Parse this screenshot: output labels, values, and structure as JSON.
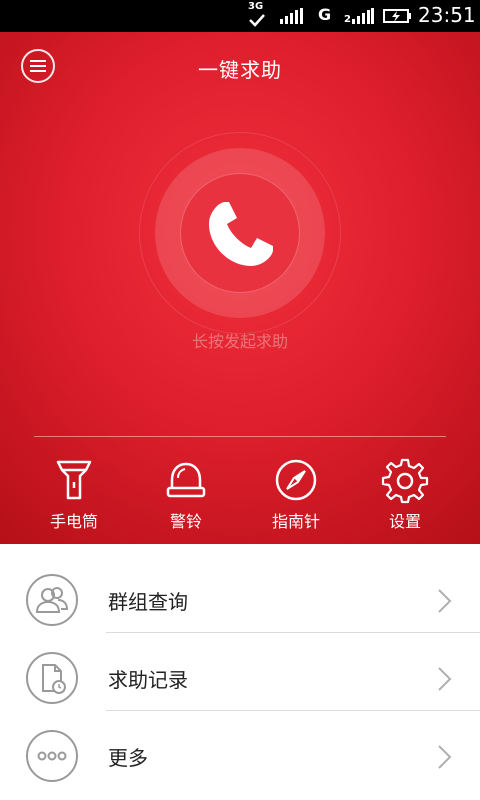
{
  "status_bar": {
    "network_label": "3G",
    "g_label": "G",
    "time": "23:51"
  },
  "header": {
    "title": "一键求助",
    "menu_icon": "menu-icon"
  },
  "call": {
    "hint": "长按发起求助",
    "icon": "phone-icon"
  },
  "tools": [
    {
      "label": "手电筒",
      "icon": "flashlight-icon"
    },
    {
      "label": "警铃",
      "icon": "alarm-bell-icon"
    },
    {
      "label": "指南针",
      "icon": "compass-icon"
    },
    {
      "label": "设置",
      "icon": "gear-icon"
    }
  ],
  "list": [
    {
      "label": "群组查询",
      "icon": "group-icon"
    },
    {
      "label": "求助记录",
      "icon": "history-document-icon"
    },
    {
      "label": "更多",
      "icon": "more-dots-icon"
    }
  ],
  "colors": {
    "hero_red": "#df1f2d",
    "hero_red_dark": "#b30f17",
    "icon_grey": "#9a9a9a"
  }
}
